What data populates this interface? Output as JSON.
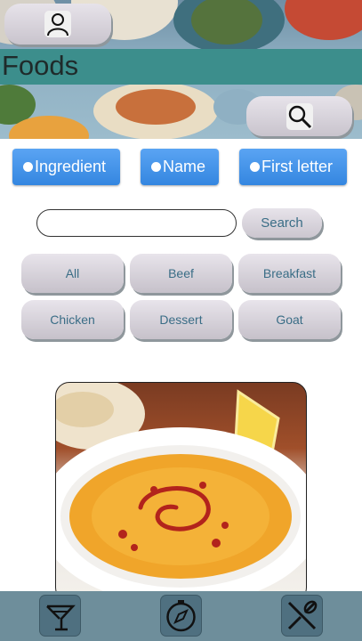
{
  "header": {
    "title": "Foods"
  },
  "search_mode": {
    "options": [
      "Ingredient",
      "Name",
      "First letter"
    ]
  },
  "search": {
    "value": "",
    "placeholder": "",
    "button_label": "Search"
  },
  "categories": [
    "All",
    "Beef",
    "Breakfast",
    "Chicken",
    "Dessert",
    "Goat"
  ],
  "bottom_nav": {
    "items": [
      "cocktail-icon",
      "compass-icon",
      "cutlery-icon"
    ]
  },
  "colors": {
    "header_bar": "#3c8e8c",
    "radio_blue": "#3486e0",
    "nav_bar": "#6e8e9b",
    "category_text": "#3a6d86"
  }
}
